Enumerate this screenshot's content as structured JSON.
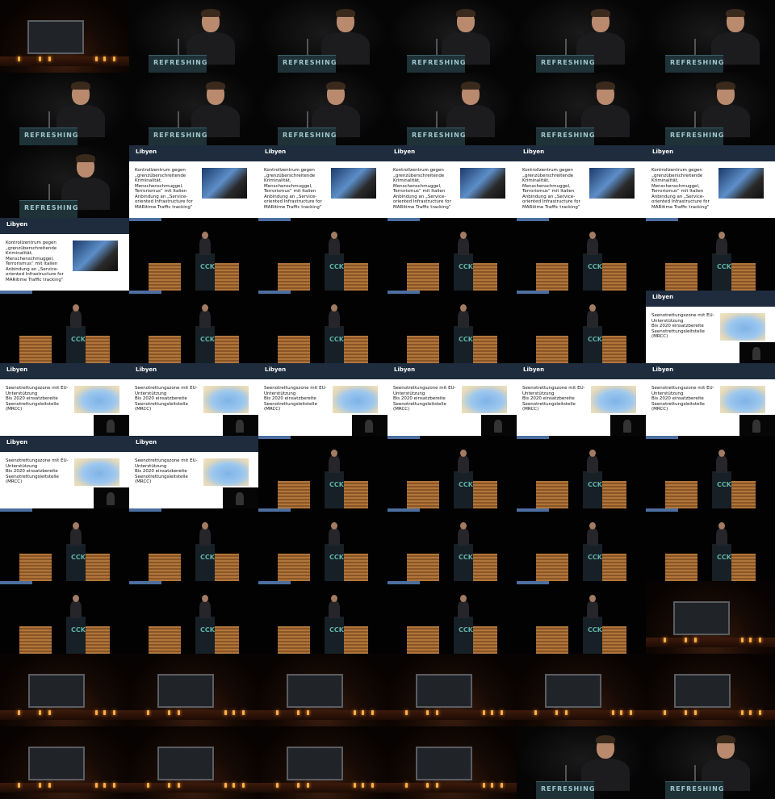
{
  "slides": {
    "title": "Libyen",
    "kontroll_text": [
      "Kontrollzentrum gegen",
      "„grenzüberschreitende",
      "Kriminalität,",
      "Menschenschmuggel,",
      "Terrorismus“ mit Italien",
      "Anbindung an „Service-",
      "oriented Infrastructure for",
      "MARitime Traffic tracking“"
    ],
    "seenot_text": [
      "Seenotrettungszone mit EU-",
      "Unterstützung",
      "Bis 2020 einsatzbereite",
      "Seenotrettungsleitstelle",
      "(MRCC)"
    ]
  },
  "podium": {
    "sign": "REFRESHING",
    "logo": "CCK"
  },
  "tiles": [
    "hall",
    "close",
    "close",
    "close",
    "close",
    "close",
    "close",
    "close",
    "close",
    "close",
    "close",
    "close",
    "close",
    "slide-k",
    "slide-k",
    "slide-k",
    "slide-k",
    "slide-k",
    "slide-k",
    "wood",
    "wood",
    "wood",
    "wood",
    "wood",
    "wood",
    "wood",
    "wood",
    "wood",
    "wood",
    "slide-s",
    "slide-s",
    "slide-s",
    "slide-s",
    "slide-s",
    "slide-s",
    "slide-s",
    "slide-s",
    "slide-s",
    "wood",
    "wood",
    "wood",
    "wood",
    "wood",
    "wood",
    "wood",
    "wood",
    "wood",
    "wood",
    "wood",
    "wood",
    "wood",
    "wood",
    "wood",
    "hall",
    "hall",
    "hall",
    "hall",
    "hall",
    "hall",
    "hall",
    "hall",
    "hall",
    "hall",
    "hall",
    "close",
    "close"
  ]
}
